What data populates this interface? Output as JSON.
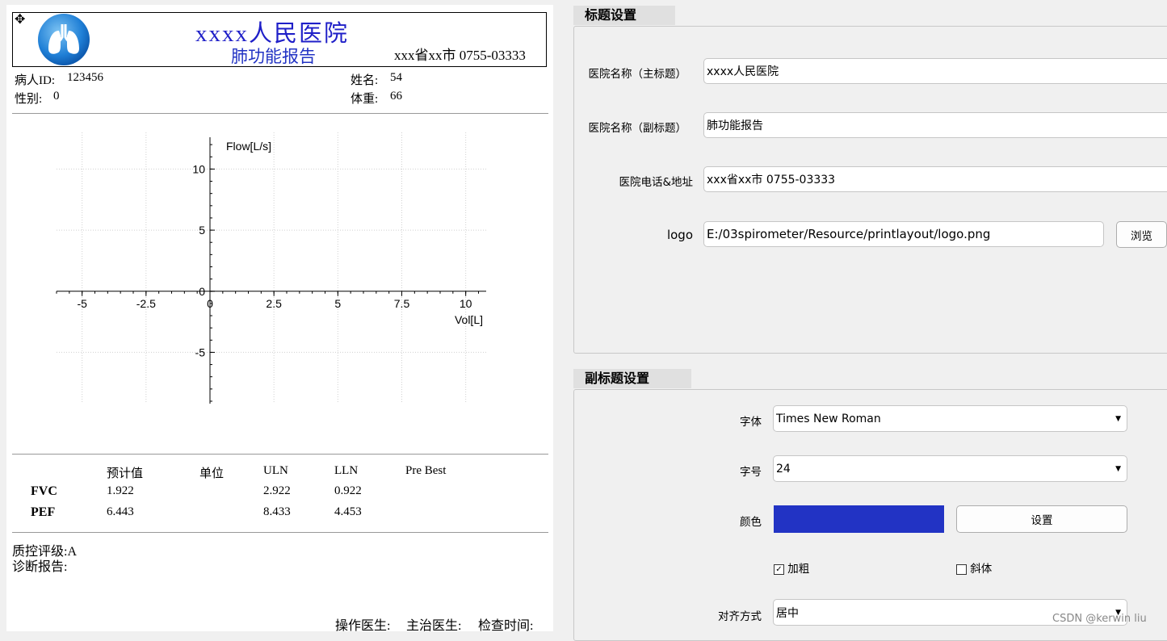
{
  "report": {
    "move_glyph": "✥",
    "hospital_name": "xxxx人民医院",
    "report_title": "肺功能报告",
    "address_phone": "xxx省xx市 0755-03333",
    "patient": {
      "id_label": "病人ID:",
      "id_value": "123456",
      "name_label": "姓名:",
      "name_value": "54",
      "sex_label": "性别:",
      "sex_value": "0",
      "weight_label": "体重:",
      "weight_value": "66"
    },
    "table": {
      "headers": [
        "预计值",
        "单位",
        "ULN",
        "LLN",
        "Pre Best"
      ],
      "rows": [
        {
          "name": "FVC",
          "pred": "1.922",
          "unit": "",
          "uln": "2.922",
          "lln": "0.922",
          "best": ""
        },
        {
          "name": "PEF",
          "pred": "6.443",
          "unit": "",
          "uln": "8.433",
          "lln": "4.453",
          "best": ""
        }
      ]
    },
    "qc_grade": "质控评级:A",
    "diagnosis_label": "诊断报告:",
    "operator_label": "操作医生:",
    "attending_label": "主治医生:",
    "exam_time_label": "检查时间:"
  },
  "chart_data": {
    "type": "line",
    "ylabel": "Flow[L/s]",
    "xlabel": "Vol[L]",
    "xlim": [
      -6,
      10.8
    ],
    "ylim": [
      -9.2,
      13
    ],
    "x_ticks": [
      -5,
      -2.5,
      0,
      2.5,
      5,
      7.5,
      10
    ],
    "x_tick_labels": [
      "-5",
      "-2.5",
      "0",
      "2.5",
      "5",
      "7.5",
      "10"
    ],
    "y_ticks": [
      -5,
      0,
      5,
      10
    ],
    "y_tick_labels": [
      "-5",
      "0",
      "5",
      "10"
    ],
    "grid": true,
    "series": []
  },
  "settings": {
    "title_section": {
      "label": "标题设置",
      "main_title_label": "医院名称（主标题）",
      "main_title_value": "xxxx人民医院",
      "subtitle_label": "医院名称（副标题）",
      "subtitle_value": "肺功能报告",
      "contact_label": "医院电话&地址",
      "contact_value": "xxx省xx市 0755-03333",
      "logo_label": "logo",
      "logo_value": "E:/03spirometer/Resource/printlayout/logo.png",
      "browse_label": "浏览"
    },
    "subtitle_section": {
      "label": "副标题设置",
      "font_label": "字体",
      "font_value": "Times New Roman",
      "size_label": "字号",
      "size_value": "24",
      "color_label": "颜色",
      "color_value": "#2233c4",
      "set_color_label": "设置",
      "bold_label": "加粗",
      "bold_checked": true,
      "italic_label": "斜体",
      "italic_checked": false,
      "align_label": "对齐方式",
      "align_value": "居中"
    }
  },
  "watermark": "CSDN @kerwin liu",
  "colors": {
    "title_blue": "#1f1fc8",
    "subtitle_blue": "#2233c4"
  }
}
